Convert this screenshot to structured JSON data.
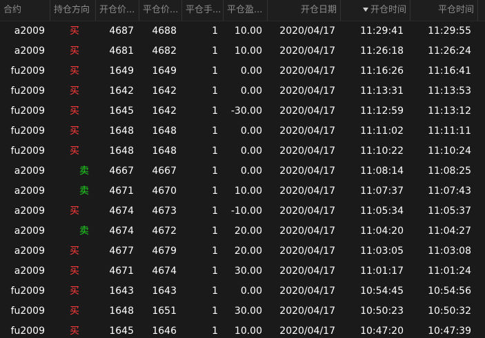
{
  "colors": {
    "background": "#1a1a1a",
    "header_text": "#8c8c8c",
    "cell_text": "#ffffff",
    "buy_color": "#ff3b3b",
    "sell_color": "#1fd11f"
  },
  "columns": [
    {
      "key": "contract",
      "label": "合约"
    },
    {
      "key": "direction",
      "label": "持仓方向"
    },
    {
      "key": "open_price",
      "label": "开仓价..."
    },
    {
      "key": "close_price",
      "label": "平仓价..."
    },
    {
      "key": "close_qty",
      "label": "平仓手..."
    },
    {
      "key": "close_pnl",
      "label": "平仓盈..."
    },
    {
      "key": "open_date",
      "label": "开仓日期"
    },
    {
      "key": "open_time",
      "label": "开仓时间",
      "sorted": "desc"
    },
    {
      "key": "close_time",
      "label": "平仓时间"
    }
  ],
  "rows": [
    {
      "contract": "a2009",
      "direction": "买",
      "side": "buy",
      "open_price": "4687",
      "close_price": "4688",
      "close_qty": "1",
      "close_pnl": "10.00",
      "open_date": "2020/04/17",
      "open_time": "11:29:41",
      "close_time": "11:29:55"
    },
    {
      "contract": "a2009",
      "direction": "买",
      "side": "buy",
      "open_price": "4681",
      "close_price": "4682",
      "close_qty": "1",
      "close_pnl": "10.00",
      "open_date": "2020/04/17",
      "open_time": "11:26:18",
      "close_time": "11:26:24"
    },
    {
      "contract": "fu2009",
      "direction": "买",
      "side": "buy",
      "open_price": "1649",
      "close_price": "1649",
      "close_qty": "1",
      "close_pnl": "0.00",
      "open_date": "2020/04/17",
      "open_time": "11:16:26",
      "close_time": "11:16:41"
    },
    {
      "contract": "fu2009",
      "direction": "买",
      "side": "buy",
      "open_price": "1642",
      "close_price": "1642",
      "close_qty": "1",
      "close_pnl": "0.00",
      "open_date": "2020/04/17",
      "open_time": "11:13:31",
      "close_time": "11:13:53"
    },
    {
      "contract": "fu2009",
      "direction": "买",
      "side": "buy",
      "open_price": "1645",
      "close_price": "1642",
      "close_qty": "1",
      "close_pnl": "-30.00",
      "open_date": "2020/04/17",
      "open_time": "11:12:59",
      "close_time": "11:13:12"
    },
    {
      "contract": "fu2009",
      "direction": "买",
      "side": "buy",
      "open_price": "1648",
      "close_price": "1648",
      "close_qty": "1",
      "close_pnl": "0.00",
      "open_date": "2020/04/17",
      "open_time": "11:11:02",
      "close_time": "11:11:11"
    },
    {
      "contract": "fu2009",
      "direction": "买",
      "side": "buy",
      "open_price": "1648",
      "close_price": "1648",
      "close_qty": "1",
      "close_pnl": "0.00",
      "open_date": "2020/04/17",
      "open_time": "11:10:22",
      "close_time": "11:10:24"
    },
    {
      "contract": "a2009",
      "direction": "卖",
      "side": "sell",
      "open_price": "4667",
      "close_price": "4667",
      "close_qty": "1",
      "close_pnl": "0.00",
      "open_date": "2020/04/17",
      "open_time": "11:08:14",
      "close_time": "11:08:25"
    },
    {
      "contract": "a2009",
      "direction": "卖",
      "side": "sell",
      "open_price": "4671",
      "close_price": "4670",
      "close_qty": "1",
      "close_pnl": "10.00",
      "open_date": "2020/04/17",
      "open_time": "11:07:37",
      "close_time": "11:07:43"
    },
    {
      "contract": "a2009",
      "direction": "买",
      "side": "buy",
      "open_price": "4674",
      "close_price": "4673",
      "close_qty": "1",
      "close_pnl": "-10.00",
      "open_date": "2020/04/17",
      "open_time": "11:05:34",
      "close_time": "11:05:37"
    },
    {
      "contract": "a2009",
      "direction": "卖",
      "side": "sell",
      "open_price": "4674",
      "close_price": "4672",
      "close_qty": "1",
      "close_pnl": "20.00",
      "open_date": "2020/04/17",
      "open_time": "11:04:20",
      "close_time": "11:04:27"
    },
    {
      "contract": "a2009",
      "direction": "买",
      "side": "buy",
      "open_price": "4677",
      "close_price": "4679",
      "close_qty": "1",
      "close_pnl": "20.00",
      "open_date": "2020/04/17",
      "open_time": "11:03:05",
      "close_time": "11:03:08"
    },
    {
      "contract": "a2009",
      "direction": "买",
      "side": "buy",
      "open_price": "4671",
      "close_price": "4674",
      "close_qty": "1",
      "close_pnl": "30.00",
      "open_date": "2020/04/17",
      "open_time": "11:01:17",
      "close_time": "11:01:24"
    },
    {
      "contract": "fu2009",
      "direction": "买",
      "side": "buy",
      "open_price": "1643",
      "close_price": "1643",
      "close_qty": "1",
      "close_pnl": "0.00",
      "open_date": "2020/04/17",
      "open_time": "10:54:45",
      "close_time": "10:54:56"
    },
    {
      "contract": "fu2009",
      "direction": "买",
      "side": "buy",
      "open_price": "1648",
      "close_price": "1651",
      "close_qty": "1",
      "close_pnl": "30.00",
      "open_date": "2020/04/17",
      "open_time": "10:50:23",
      "close_time": "10:50:32"
    },
    {
      "contract": "fu2009",
      "direction": "买",
      "side": "buy",
      "open_price": "1645",
      "close_price": "1646",
      "close_qty": "1",
      "close_pnl": "10.00",
      "open_date": "2020/04/17",
      "open_time": "10:47:20",
      "close_time": "10:47:39"
    }
  ]
}
